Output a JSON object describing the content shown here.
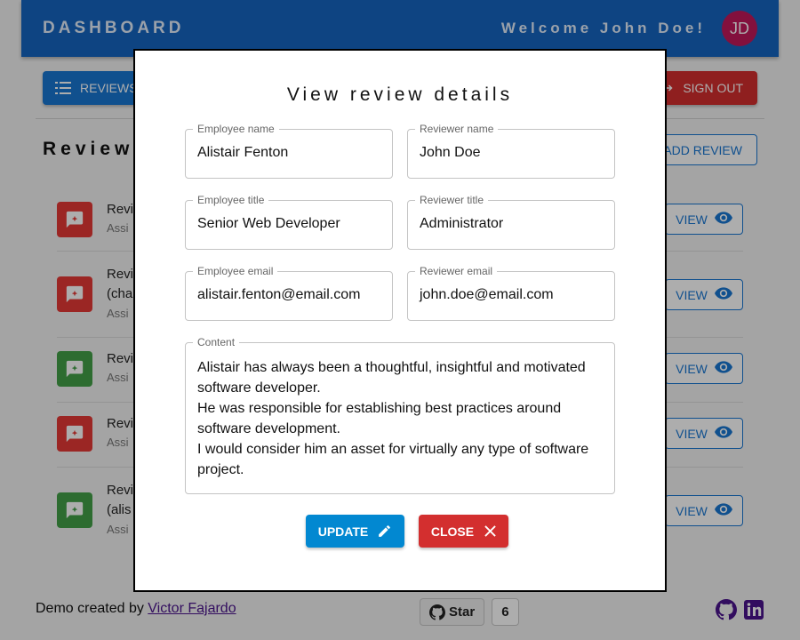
{
  "appbar": {
    "brand": "DASHBOARD",
    "welcome": "Welcome John Doe!",
    "avatar_initials": "JD"
  },
  "toolbar": {
    "reviews_label": "REVIEWS",
    "signout_label": "SIGN OUT"
  },
  "reviews_section": {
    "title": "Reviews",
    "add_label": "ADD REVIEW",
    "items": [
      {
        "title": "Revi",
        "subtitle": "Assi",
        "icon": "rate-review-icon",
        "color": "#e53935",
        "view_label": "VIEW"
      },
      {
        "title": "Revi",
        "title2": "(cha",
        "subtitle": "Assi",
        "icon": "rate-review-icon",
        "color": "#e53935",
        "view_label": "VIEW"
      },
      {
        "title": "Revi",
        "subtitle": "Assi",
        "icon": "rate-review-icon",
        "color": "#43a047",
        "view_label": "VIEW"
      },
      {
        "title": "Revi",
        "subtitle": "Assi",
        "icon": "rate-review-icon",
        "color": "#e53935",
        "view_label": "VIEW"
      },
      {
        "title": "Revi",
        "title2": "(alis",
        "subtitle": "Assi",
        "icon": "rate-review-icon",
        "color": "#43a047",
        "view_label": "VIEW"
      }
    ]
  },
  "footer": {
    "text": "Demo created by ",
    "author": "Victor Fajardo",
    "star_label": "Star",
    "star_count": "6"
  },
  "modal": {
    "title": "View review details",
    "fields": {
      "employee_name": {
        "label": "Employee name",
        "value": "Alistair Fenton"
      },
      "reviewer_name": {
        "label": "Reviewer name",
        "value": "John Doe"
      },
      "employee_title": {
        "label": "Employee title",
        "value": "Senior Web Developer"
      },
      "reviewer_title": {
        "label": "Reviewer title",
        "value": "Administrator"
      },
      "employee_email": {
        "label": "Employee email",
        "value": "alistair.fenton@email.com"
      },
      "reviewer_email": {
        "label": "Reviewer email",
        "value": "john.doe@email.com"
      },
      "content": {
        "label": "Content",
        "value": "Alistair has always been a thoughtful, insightful and motivated software developer.\nHe was responsible for establishing best practices around software development.\nI would consider him an asset for virtually any type of software project."
      }
    },
    "update_label": "UPDATE",
    "close_label": "CLOSE"
  },
  "colors": {
    "primary": "#1565c0",
    "danger": "#d32f2f",
    "info": "#0288d1",
    "success": "#43a047"
  }
}
